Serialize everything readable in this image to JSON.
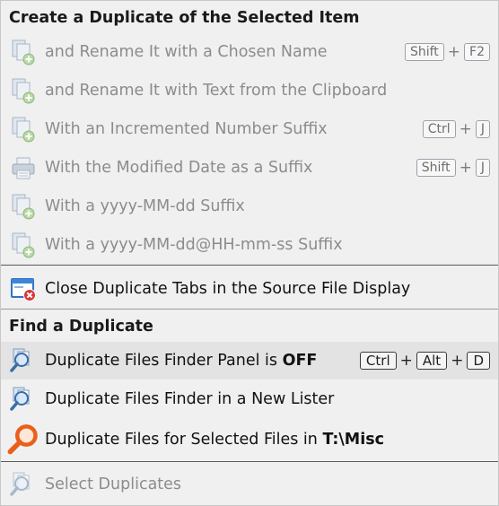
{
  "sections": {
    "duplicate_header": "Create a Duplicate of the Selected Item",
    "find_header": "Find a Duplicate"
  },
  "items": {
    "rename_chosen": {
      "label": "and Rename It with a Chosen Name",
      "keys": [
        "Shift",
        "F2"
      ]
    },
    "rename_clipboard": {
      "label": "and Rename It with Text from the Clipboard"
    },
    "incremented": {
      "label": "With an Incremented Number Suffix",
      "keys": [
        "Ctrl",
        "J"
      ]
    },
    "modified_date": {
      "label": "With the Modified Date as a Suffix",
      "keys": [
        "Shift",
        "J"
      ]
    },
    "date_suffix": {
      "label": "With a yyyy-MM-dd Suffix"
    },
    "datetime_suffix": {
      "label": "With a yyyy-MM-dd@HH-mm-ss Suffix"
    },
    "close_tabs": {
      "label": "Close Duplicate Tabs in the Source File Display"
    },
    "finder_panel": {
      "label_prefix": "Duplicate Files Finder Panel is ",
      "label_state": "OFF",
      "keys": [
        "Ctrl",
        "Alt",
        "D"
      ]
    },
    "finder_lister": {
      "label": "Duplicate Files Finder in a New Lister"
    },
    "for_selected": {
      "label_prefix": "Duplicate Files for Selected Files in ",
      "label_path": "T:\\Misc"
    },
    "select_duplicates": {
      "label": "Select Duplicates"
    }
  },
  "plus_sign": "+",
  "colors": {
    "menu_bg": "#f0f0f0",
    "disabled_text": "#8c8c8c",
    "enabled_text": "#111111",
    "highlight": "#e3e3e3",
    "magnifier_orange": "#e8601c"
  }
}
